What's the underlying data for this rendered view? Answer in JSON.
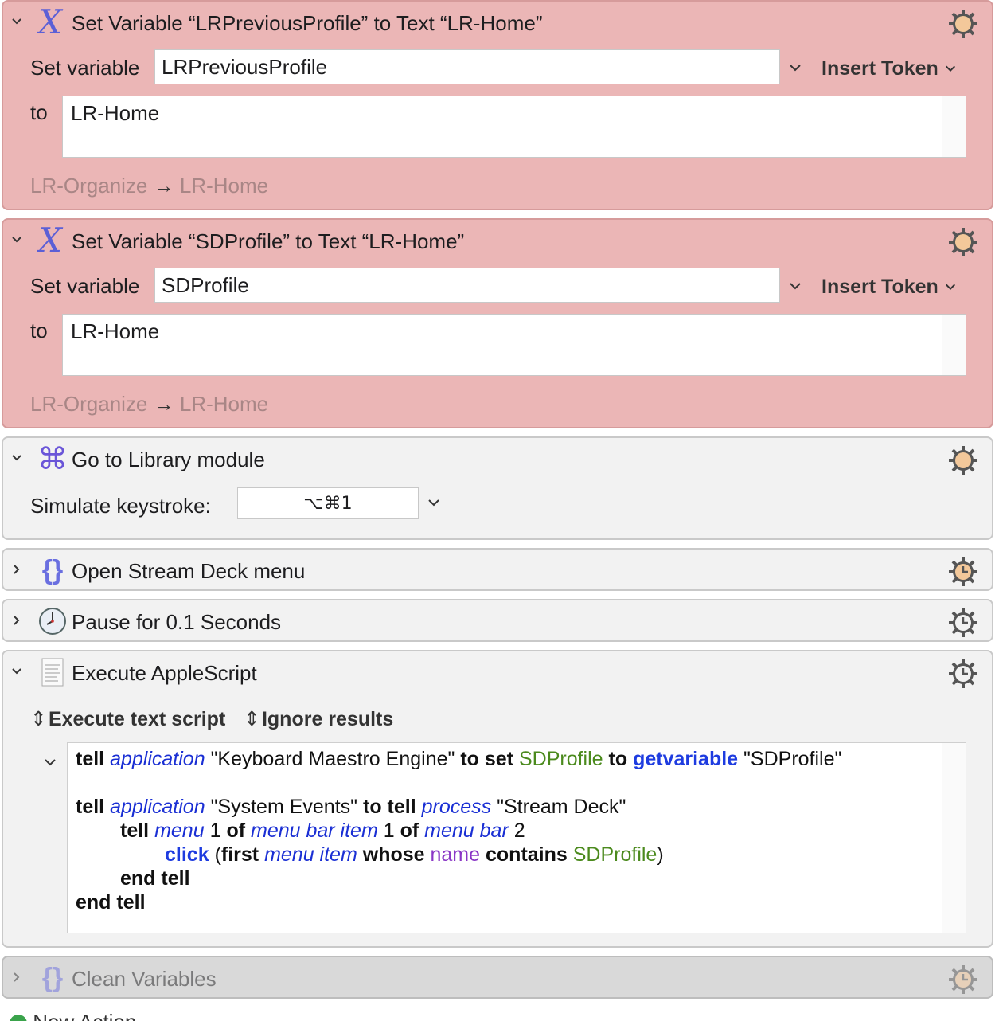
{
  "actions": [
    {
      "title": "Set Variable “LRPreviousProfile” to Text “LR-Home”",
      "set_variable_label": "Set variable",
      "variable_value": "LRPreviousProfile",
      "insert_token_label": "Insert Token",
      "to_label": "to",
      "text_value": "LR-Home",
      "hint_from": "LR-Organize",
      "hint_arrow": "→",
      "hint_to": "LR-Home",
      "icon": "variable-x-icon",
      "color": "#ebb6b6"
    },
    {
      "title": "Set Variable “SDProfile” to Text “LR-Home”",
      "set_variable_label": "Set variable",
      "variable_value": "SDProfile",
      "insert_token_label": "Insert Token",
      "to_label": "to",
      "text_value": "LR-Home",
      "hint_from": "LR-Organize",
      "hint_arrow": "→",
      "hint_to": "LR-Home",
      "icon": "variable-x-icon",
      "color": "#ebb6b6"
    },
    {
      "title": "Go to Library module",
      "keystroke_label": "Simulate keystroke:",
      "keystroke_value": "⌥⌘1",
      "icon": "command-key-icon"
    },
    {
      "title": "Open Stream Deck menu",
      "icon": "braces-icon"
    },
    {
      "title": "Pause for 0.1 Seconds",
      "icon": "clock-icon"
    },
    {
      "title": "Execute AppleScript",
      "mode_label": "Execute text script",
      "results_label": "Ignore results",
      "icon": "script-document-icon",
      "script": {
        "l1": [
          "tell",
          "application",
          "\"Keyboard Maestro Engine\"",
          "to set",
          "SDProfile",
          "to",
          "getvariable",
          "\"SDProfile\""
        ],
        "l3": [
          "tell",
          "application",
          "\"System Events\"",
          "to tell",
          "process",
          "\"Stream Deck\""
        ],
        "l4": [
          "tell",
          "menu",
          "1",
          "of",
          "menu bar item",
          "1",
          "of",
          "menu bar",
          "2"
        ],
        "l5": [
          "click",
          "(",
          "first",
          "menu item",
          "whose",
          "name",
          "contains",
          "SDProfile",
          ")"
        ],
        "l6": "end tell",
        "l7": "end tell"
      }
    },
    {
      "title": "Clean Variables",
      "icon": "braces-icon",
      "state": "disabled"
    }
  ],
  "footer": {
    "new_action_label": "New Action"
  }
}
